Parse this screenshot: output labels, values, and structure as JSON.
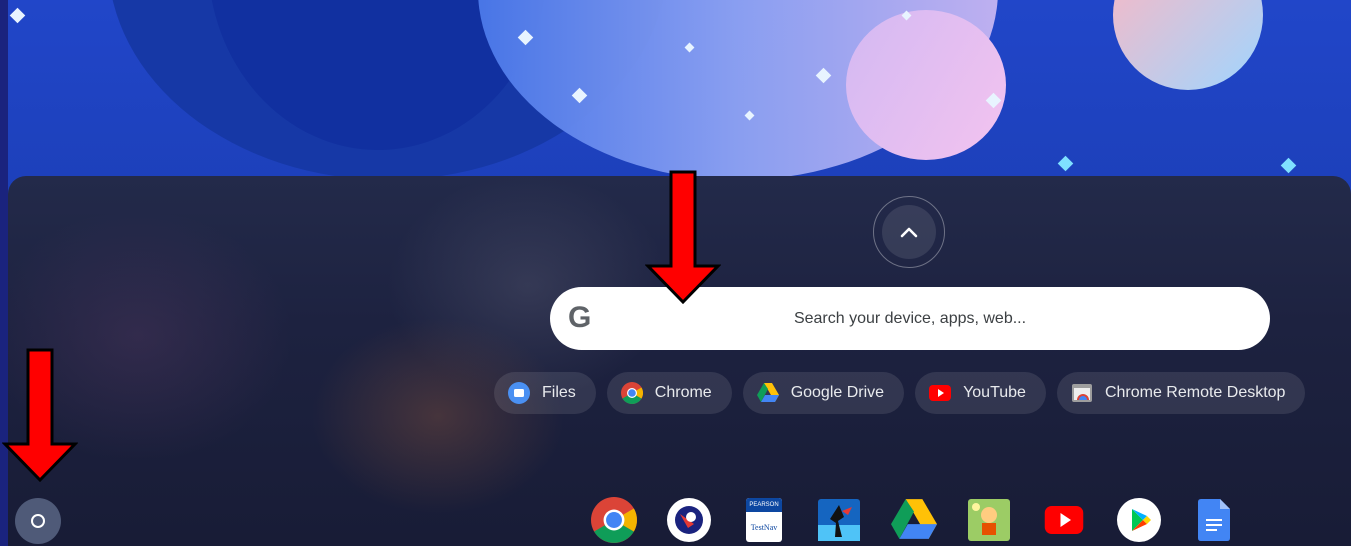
{
  "search": {
    "logo": "G",
    "placeholder": "Search your device, apps, web..."
  },
  "suggested_apps": [
    {
      "label": "Files",
      "icon": "files-icon"
    },
    {
      "label": "Chrome",
      "icon": "chrome-icon"
    },
    {
      "label": "Google Drive",
      "icon": "google-drive-icon"
    },
    {
      "label": "YouTube",
      "icon": "youtube-icon"
    },
    {
      "label": "Chrome Remote Desktop",
      "icon": "chrome-remote-desktop-icon"
    }
  ],
  "shelf_apps": [
    {
      "name": "chrome-icon"
    },
    {
      "name": "app-circle-icon"
    },
    {
      "name": "pearson-testnav-icon",
      "text_top": "PEARSON",
      "text_bottom": "TestNav"
    },
    {
      "name": "game-icon"
    },
    {
      "name": "google-drive-icon"
    },
    {
      "name": "character-game-icon"
    },
    {
      "name": "youtube-icon"
    },
    {
      "name": "play-store-icon"
    },
    {
      "name": "google-docs-icon"
    }
  ],
  "colors": {
    "annotation_arrow": "#ff0000",
    "launcher_bg": "#1d2240",
    "search_bg": "#ffffff",
    "chip_text": "#e8eaed"
  }
}
